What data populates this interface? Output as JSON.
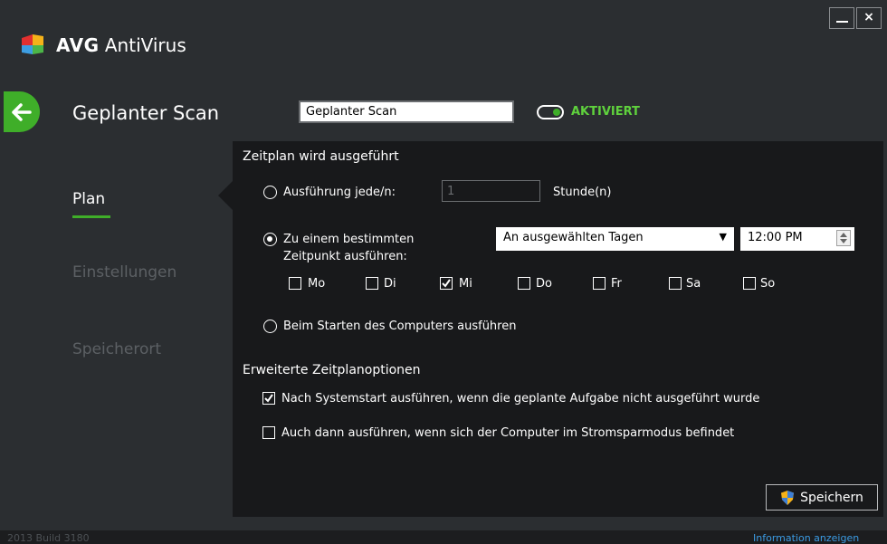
{
  "app": {
    "brand": "AVG",
    "product": "AntiVirus",
    "close_glyph": "×"
  },
  "header": {
    "title": "Geplanter Scan",
    "name_value": "Geplanter Scan",
    "toggle_label": "AKTIVIERT",
    "toggle_on": true
  },
  "nav": {
    "items": [
      {
        "label": "Plan",
        "active": true
      },
      {
        "label": "Einstellungen",
        "active": false
      },
      {
        "label": "Speicherort",
        "active": false
      }
    ]
  },
  "schedule": {
    "section_title": "Zeitplan wird ausgeführt",
    "option_interval": {
      "label": "Ausführung jede/n:",
      "value": "1",
      "unit": "Stunde(n)",
      "selected": false
    },
    "option_specific": {
      "label_line1": "Zu einem bestimmten",
      "label_line2": "Zeitpunkt ausführen:",
      "selected": true,
      "dropdown_value": "An ausgewählten Tagen",
      "dropdown_arrow": "▼",
      "time_value": "12:00 PM"
    },
    "days": [
      {
        "label": "Mo",
        "checked": false
      },
      {
        "label": "Di",
        "checked": false
      },
      {
        "label": "Mi",
        "checked": true
      },
      {
        "label": "Do",
        "checked": false
      },
      {
        "label": "Fr",
        "checked": false
      },
      {
        "label": "Sa",
        "checked": false
      },
      {
        "label": "So",
        "checked": false
      }
    ],
    "option_startup": {
      "label": "Beim Starten des Computers ausführen",
      "selected": false
    }
  },
  "advanced": {
    "section_title": "Erweiterte Zeitplanoptionen",
    "run_after_startup": {
      "label": "Nach Systemstart ausführen, wenn die geplante Aufgabe nicht ausgeführt wurde",
      "checked": true
    },
    "run_power_saving": {
      "label": "Auch dann ausführen, wenn sich der Computer im Stromsparmodus befindet",
      "checked": false
    }
  },
  "save_label": "Speichern",
  "footer": {
    "build": "2013  Build 3180",
    "info_link": "Information anzeigen"
  },
  "colors": {
    "accent_green": "#3fae29",
    "active_text_green": "#5fd13d",
    "link_blue": "#3b9be3",
    "background": "#2b2e31",
    "panel": "#18191b"
  },
  "icons": {
    "logo": "avg-logo-icon",
    "back": "arrow-left-icon",
    "save": "uac-shield-icon",
    "minimize": "minimize-icon",
    "close": "close-icon"
  }
}
